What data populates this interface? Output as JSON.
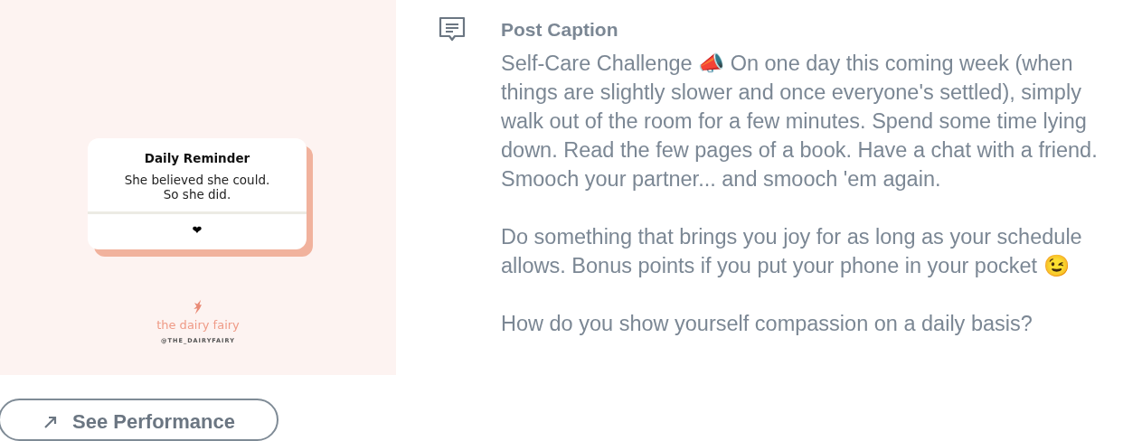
{
  "post_image": {
    "card_title": "Daily Reminder",
    "card_text": "She believed she could.\nSo she did.",
    "card_symbol": "❤",
    "brand": "the dairy fairy",
    "handle": "@THE_DAIRYFAIRY"
  },
  "performance_button": {
    "label": "See Performance"
  },
  "caption": {
    "heading": "Post Caption",
    "paragraphs": [
      "Self-Care Challenge 📣 On one day this coming week (when things are slightly slower and once everyone's settled), simply walk out of the room for a few minutes. Spend some time lying down. Read the few pages of a book. Have a chat with a friend. Smooch your partner... and smooch 'em again.",
      "Do something that brings you joy for as long as your schedule allows. Bonus points if you put your phone in your pocket 😉",
      "How do you show yourself compassion on a daily basis?"
    ]
  }
}
